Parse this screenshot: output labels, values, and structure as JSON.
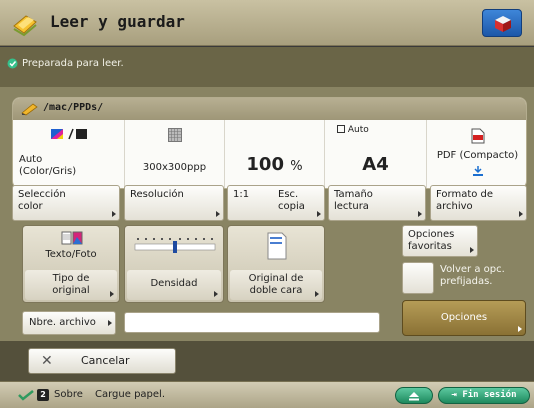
{
  "window": {
    "title": "Leer y guardar"
  },
  "status": {
    "text": "Preparada para leer."
  },
  "path": "/mac/PPDs/",
  "summary": [
    {
      "id": "color",
      "line1": "Auto",
      "line2": "(Color/Gris)"
    },
    {
      "id": "resolution",
      "line1": "300x300ppp"
    },
    {
      "id": "scale",
      "value": "100",
      "unit": "%"
    },
    {
      "id": "size",
      "auto_label": "Auto",
      "value": "A4"
    },
    {
      "id": "format",
      "line1": "PDF (Compacto)"
    }
  ],
  "function_buttons": [
    {
      "id": "seleccion-color",
      "line1": "Selección",
      "line2": "color"
    },
    {
      "id": "resolucion",
      "line1": "Resolución",
      "line2": ""
    },
    {
      "id": "esc-copia",
      "line1": "1:1",
      "line2": "",
      "aux1": "Esc.",
      "aux2": "copia"
    },
    {
      "id": "tamano-lectura",
      "line1": "Tamaño",
      "line2": "lectura"
    },
    {
      "id": "formato-archivo",
      "line1": "Formato de",
      "line2": "archivo"
    }
  ],
  "big_buttons": {
    "tipo_original": {
      "top": "Texto/Foto",
      "line1": "Tipo de",
      "line2": "original"
    },
    "densidad": {
      "label": "Densidad"
    },
    "doble_cara": {
      "line1": "Original de",
      "line2": "doble cara"
    }
  },
  "favorites": {
    "line1": "Opciones",
    "line2": "favoritas"
  },
  "reset": {
    "line1": "Volver a opc.",
    "line2": "prefijadas."
  },
  "options": {
    "label": "Opciones"
  },
  "filename": {
    "label": "Nbre. archivo",
    "value": ""
  },
  "cancel": {
    "label": "Cancelar"
  },
  "bottom": {
    "env_number": "2",
    "sobre": "Sobre",
    "message": "Cargue papel.",
    "logout": "Fin sesión"
  },
  "colors": {
    "title_bg": "#b8af8e",
    "panel_bg": "#898463",
    "accent_green": "#1e8a5e",
    "options_gold": "#9b8140"
  }
}
